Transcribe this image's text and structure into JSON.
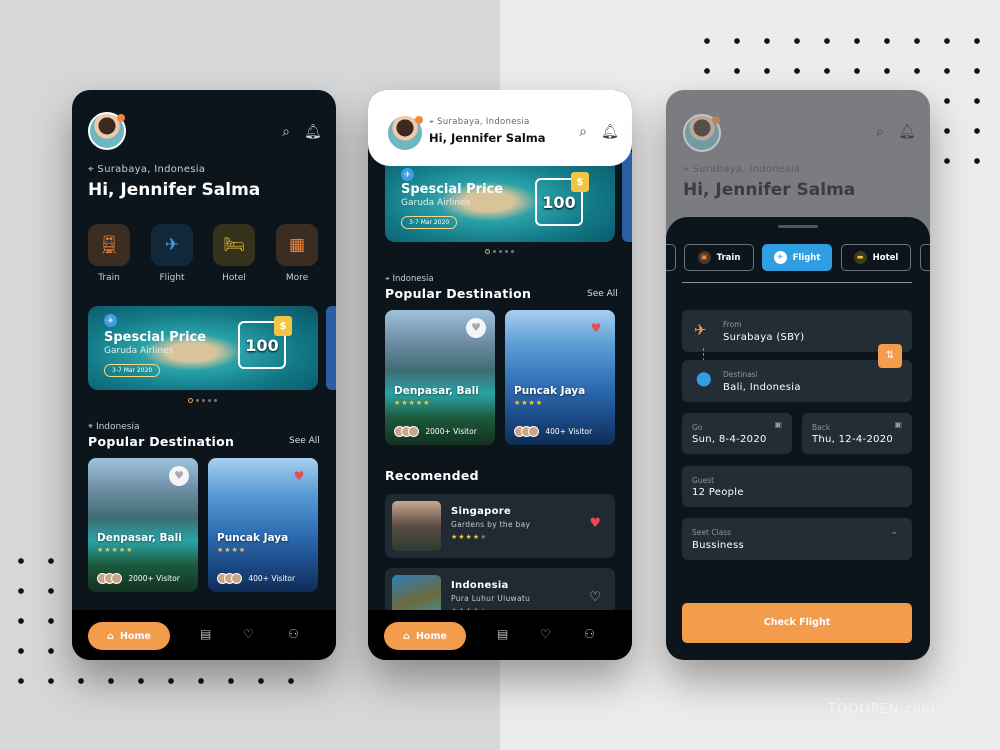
{
  "user": {
    "location": "Surabaya, Indonesia",
    "greeting": "Hi, Jennifer Salma"
  },
  "categories": [
    {
      "label": "Train",
      "icon": "train-icon",
      "color": "#f0883a",
      "bg": "#3b2d22"
    },
    {
      "label": "Flight",
      "icon": "plane-icon",
      "color": "#3fa0e8",
      "bg": "#11283a"
    },
    {
      "label": "Hotel",
      "icon": "bed-icon",
      "color": "#f2c23e",
      "bg": "#35321c"
    },
    {
      "label": "More",
      "icon": "grid-icon",
      "color": "#f0883a",
      "bg": "#3b2d22"
    }
  ],
  "promo": {
    "title": "Spescial Price",
    "airline": "Garuda Airlines",
    "date": "3-7 Mar 2020",
    "price": "100",
    "currency": "$"
  },
  "popular": {
    "region": "Indonesia",
    "title": "Popular Destination",
    "see_all": "See All",
    "destinations": [
      {
        "name": "Denpasar, Bali",
        "rating": 5,
        "visitors": "2000+ Visitor",
        "liked": false
      },
      {
        "name": "Puncak Jaya",
        "rating": 4,
        "visitors": "400+ Visitor",
        "liked": true
      }
    ]
  },
  "recommended": {
    "title": "Recomended",
    "items": [
      {
        "name": "Singapore",
        "place": "Gardens by the bay",
        "rating": 4,
        "liked": true
      },
      {
        "name": "Indonesia",
        "place": "Pura Luhur Uluwatu",
        "rating": 4,
        "liked": false
      }
    ]
  },
  "nav": {
    "home": "Home",
    "items": [
      "document-icon",
      "heart-icon",
      "profile-icon"
    ]
  },
  "booking": {
    "tabs": [
      "Train",
      "Flight",
      "Hotel"
    ],
    "active_tab": "Flight",
    "from": {
      "label": "From",
      "value": "Surabaya (SBY)"
    },
    "to": {
      "label": "Destinasi",
      "value": "Bali, Indonesia"
    },
    "go": {
      "label": "Go",
      "value": "Sun, 8-4-2020"
    },
    "back": {
      "label": "Back",
      "value": "Thu, 12-4-2020"
    },
    "guest": {
      "label": "Guest",
      "value": "12 People"
    },
    "seat": {
      "label": "Seet Class",
      "value": "Bussiness"
    },
    "submit": "Check Flight"
  },
  "colors": {
    "accent": "#f39c4b",
    "flight_blue": "#2f9ee3",
    "bg_dark": "#0d151c",
    "field": "#222d36"
  },
  "watermark": "TOOOPEN.com"
}
